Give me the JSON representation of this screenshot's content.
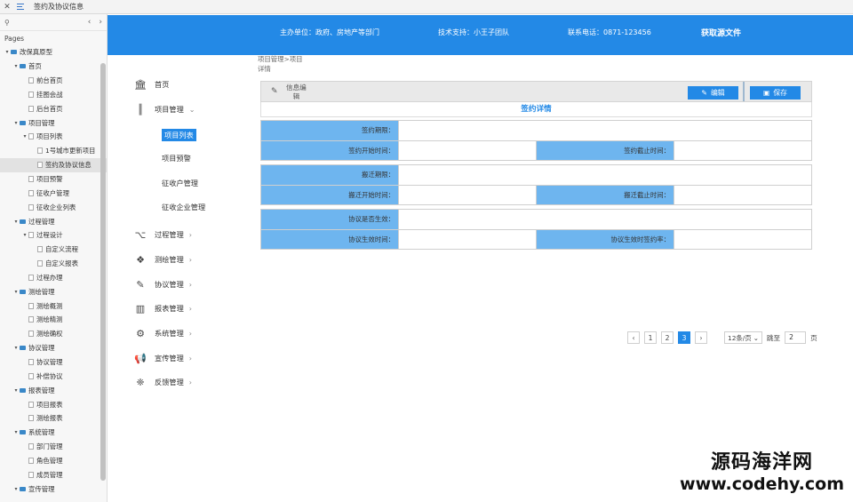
{
  "tab": {
    "close_icon": "close-icon",
    "menu_icon": "hamburger-icon",
    "title": "签约及协议信息"
  },
  "tree": {
    "search_icon": "search-icon",
    "pages_label": "Pages",
    "items": [
      {
        "label": "改保真原型",
        "level": 0,
        "kind": "folder",
        "expanded": true
      },
      {
        "label": "首页",
        "level": 1,
        "kind": "folder",
        "expanded": true
      },
      {
        "label": "前台首页",
        "level": 2,
        "kind": "page"
      },
      {
        "label": "挂图会战",
        "level": 2,
        "kind": "page"
      },
      {
        "label": "后台首页",
        "level": 2,
        "kind": "page"
      },
      {
        "label": "项目管理",
        "level": 1,
        "kind": "folder",
        "expanded": true
      },
      {
        "label": "项目列表",
        "level": 2,
        "kind": "page-parent",
        "expanded": true
      },
      {
        "label": "1号城市更新项目",
        "level": 3,
        "kind": "page"
      },
      {
        "label": "签约及协议信息",
        "level": 3,
        "kind": "page",
        "selected": true
      },
      {
        "label": "项目预警",
        "level": 2,
        "kind": "page"
      },
      {
        "label": "征收户管理",
        "level": 2,
        "kind": "page"
      },
      {
        "label": "征收企业列表",
        "level": 2,
        "kind": "page"
      },
      {
        "label": "过程管理",
        "level": 1,
        "kind": "folder",
        "expanded": true
      },
      {
        "label": "过程设计",
        "level": 2,
        "kind": "page-parent",
        "expanded": true
      },
      {
        "label": "自定义流程",
        "level": 3,
        "kind": "page"
      },
      {
        "label": "自定义报表",
        "level": 3,
        "kind": "page"
      },
      {
        "label": "过程办理",
        "level": 2,
        "kind": "page"
      },
      {
        "label": "测绘管理",
        "level": 1,
        "kind": "folder",
        "expanded": true
      },
      {
        "label": "测绘概测",
        "level": 2,
        "kind": "page"
      },
      {
        "label": "测绘精测",
        "level": 2,
        "kind": "page"
      },
      {
        "label": "测绘确权",
        "level": 2,
        "kind": "page"
      },
      {
        "label": "协议管理",
        "level": 1,
        "kind": "folder",
        "expanded": true
      },
      {
        "label": "协议管理",
        "level": 2,
        "kind": "page"
      },
      {
        "label": "补偿协议",
        "level": 2,
        "kind": "page"
      },
      {
        "label": "报表管理",
        "level": 1,
        "kind": "folder",
        "expanded": true
      },
      {
        "label": "项目报表",
        "level": 2,
        "kind": "page"
      },
      {
        "label": "测绘报表",
        "level": 2,
        "kind": "page"
      },
      {
        "label": "系统管理",
        "level": 1,
        "kind": "folder",
        "expanded": true
      },
      {
        "label": "部门管理",
        "level": 2,
        "kind": "page"
      },
      {
        "label": "角色管理",
        "level": 2,
        "kind": "page"
      },
      {
        "label": "成员管理",
        "level": 2,
        "kind": "page"
      },
      {
        "label": "宣传管理",
        "level": 1,
        "kind": "folder",
        "expanded": true
      }
    ]
  },
  "header": {
    "sponsor": "主办单位：政府、房地产等部门",
    "tech": "技术支持：小王子团队",
    "contact": "联系电话：0871-123456",
    "source": "获取源文件"
  },
  "nav": {
    "items": [
      {
        "label": "首页",
        "icon": "bank-icon",
        "glyph": "🏛",
        "chevron": ""
      },
      {
        "label": "项目管理",
        "icon": "barcode-icon",
        "glyph": "║",
        "chevron": "⌄"
      },
      {
        "label": "过程管理",
        "icon": "branch-icon",
        "glyph": "⌥",
        "chevron": "›"
      },
      {
        "label": "测绘管理",
        "icon": "cubes-icon",
        "glyph": "❖",
        "chevron": "›"
      },
      {
        "label": "协议管理",
        "icon": "edit-icon",
        "glyph": "✎",
        "chevron": "›"
      },
      {
        "label": "报表管理",
        "icon": "bar-chart-icon",
        "glyph": "▥",
        "chevron": "›"
      },
      {
        "label": "系统管理",
        "icon": "gear-icon",
        "glyph": "⚙",
        "chevron": "›"
      },
      {
        "label": "宣传管理",
        "icon": "megaphone-icon",
        "glyph": "📢",
        "chevron": "›"
      },
      {
        "label": "反馈管理",
        "icon": "dropbox-icon",
        "glyph": "❈",
        "chevron": "›"
      }
    ],
    "sub": [
      {
        "label": "项目列表",
        "active": true
      },
      {
        "label": "项目预警",
        "active": false
      },
      {
        "label": "征收户管理",
        "active": false
      },
      {
        "label": "征收企业管理",
        "active": false
      }
    ]
  },
  "breadcrumb": {
    "line1": "项目管理>项目",
    "line2": "详情"
  },
  "toolbar": {
    "info_line1": "信息编",
    "info_line2": "辑",
    "edit_label": "编辑",
    "save_label": "保存",
    "edit_icon": "edit-icon",
    "save_icon": "save-icon"
  },
  "form": {
    "title": "签约详情",
    "groups": [
      [
        [
          {
            "label": "签约期限：",
            "wide": true
          }
        ],
        [
          {
            "label": "签约开始时间："
          },
          {
            "label": "签约截止时间："
          }
        ]
      ],
      [
        [
          {
            "label": "搬迁期限：",
            "wide": true
          }
        ],
        [
          {
            "label": "搬迁开始时间："
          },
          {
            "label": "搬迁截止时间："
          }
        ]
      ],
      [
        [
          {
            "label": "协议是否生效：",
            "wide": true
          }
        ],
        [
          {
            "label": "协议生效时间："
          },
          {
            "label": "协议生效时签约率："
          }
        ]
      ]
    ]
  },
  "pager": {
    "prev": "‹",
    "pages": [
      "1",
      "2",
      "3"
    ],
    "current": "3",
    "next": "›",
    "page_size": "12条/页",
    "jump_label": "跳至",
    "jump_value": "2",
    "page_unit": "页"
  },
  "watermark": {
    "line1": "源码海洋网",
    "line2": "www.codehy.com"
  }
}
